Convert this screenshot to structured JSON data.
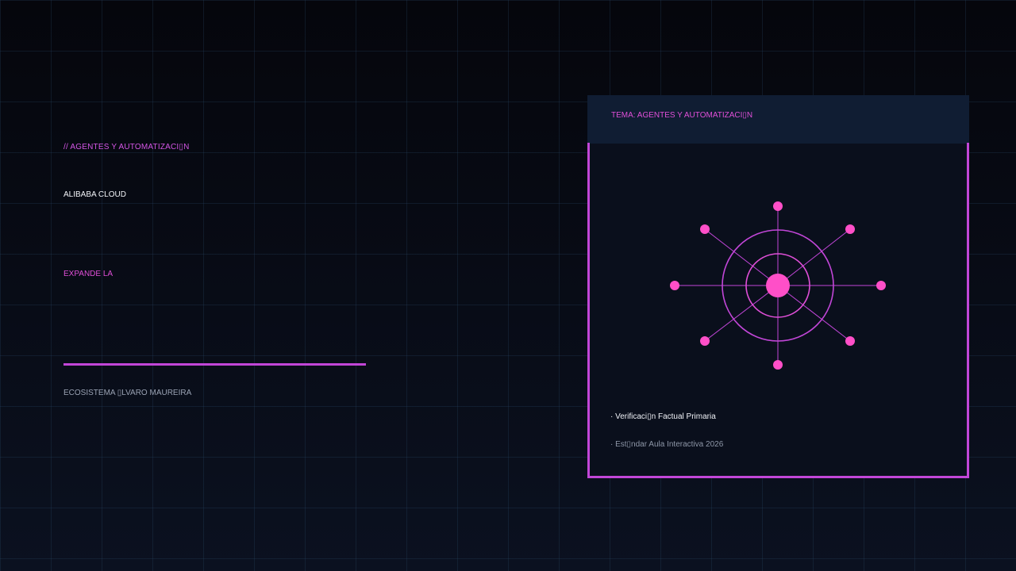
{
  "slide": {
    "kicker": "// AGENTES Y AUTOMATIZACI▯N",
    "brand": "ALIBABA CLOUD",
    "headline": "EXPANDE LA",
    "ecosystem": "ECOSISTEMA ▯LVARO MAUREIRA"
  },
  "card": {
    "title": "TEMA: AGENTES Y AUTOMATIZACI▯N",
    "icon": "hub-network-icon",
    "bullets": [
      "· Verificaci▯n Factual Primaria",
      "· Est▯ndar Aula Interactiva 2026"
    ]
  },
  "colors": {
    "background": "#05060c",
    "grid": "#1c2f45",
    "accent_magenta": "#c246d8",
    "accent_pink": "#ff4fc8",
    "card_header": "#101d33",
    "card_body": "#0a0f1c"
  }
}
